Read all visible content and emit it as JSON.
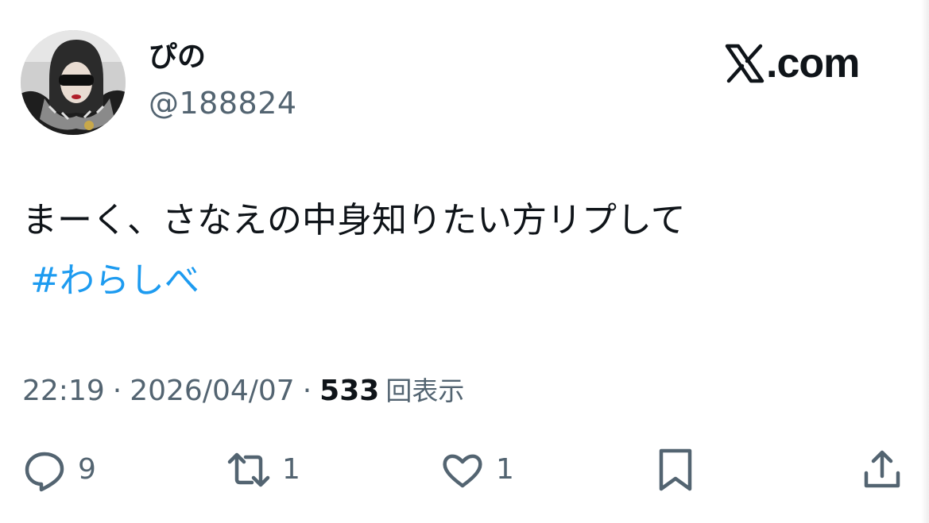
{
  "user": {
    "display_name": "ぴの",
    "handle": "@188824"
  },
  "brand": {
    "text": ".com",
    "icon": "x-logo-icon"
  },
  "tweet": {
    "text": "まーく、さなえの中身知りたい方リプして",
    "hashtag": "#わらしべ"
  },
  "meta": {
    "time": "22:19",
    "separator": "·",
    "date": "2026/04/07",
    "views_count": "533",
    "views_label": "回表示"
  },
  "actions": {
    "reply_count": "9",
    "retweet_count": "1",
    "like_count": "1"
  },
  "colors": {
    "text": "#0f1419",
    "secondary": "#536471",
    "link": "#1d9bf0"
  }
}
